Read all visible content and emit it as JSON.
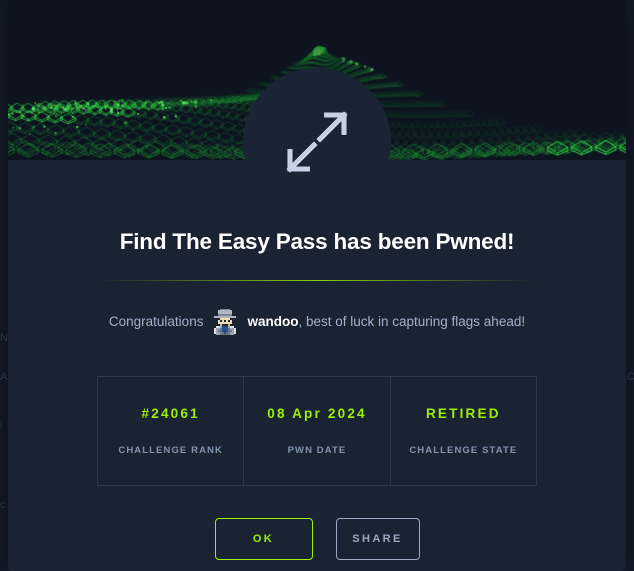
{
  "modal": {
    "icon": "expand-arrows-icon",
    "title": "Find The Easy Pass has been Pwned!",
    "congrats": {
      "prefix": "Congratulations",
      "username": "wandoo",
      "suffix": ", best of luck in capturing flags ahead!",
      "avatar": "user-avatar"
    },
    "stats": [
      {
        "value": "#24061",
        "label": "CHALLENGE RANK"
      },
      {
        "value": "08 Apr 2024",
        "label": "PWN DATE"
      },
      {
        "value": "RETIRED",
        "label": "CHALLENGE STATE"
      }
    ],
    "actions": {
      "ok_label": "OK",
      "share_label": "SHARE"
    }
  },
  "colors": {
    "accent_green": "#9fef00",
    "page_background": "#141d2b",
    "modal_background": "#1a2332",
    "banner_background": "#0d1420",
    "muted_text": "#a4b1cd",
    "border": "#2b3850"
  }
}
